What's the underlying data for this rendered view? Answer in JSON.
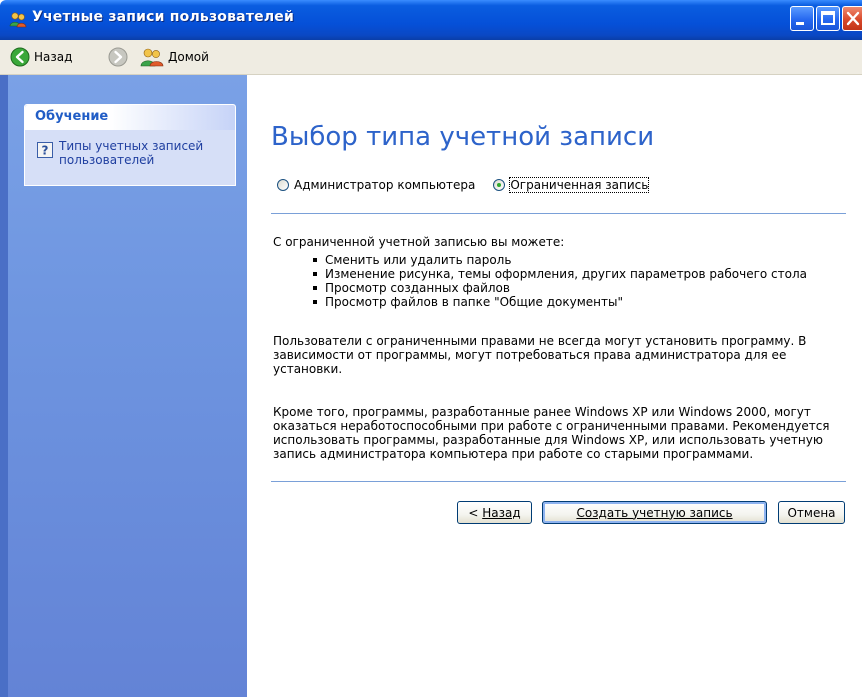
{
  "window": {
    "title": "Учетные записи пользователей"
  },
  "navbar": {
    "back_label": "Назад",
    "home_label": "Домой"
  },
  "sidebar": {
    "section_title": "Обучение",
    "links": [
      {
        "label": "Типы учетных записей пользователей",
        "icon": "help-icon"
      }
    ]
  },
  "main": {
    "heading": "Выбор типа учетной записи",
    "account_types": [
      {
        "label": "Администратор компьютера",
        "selected": false
      },
      {
        "label": "Ограниченная запись",
        "selected": true
      }
    ],
    "intro": "С ограниченной учетной записью вы можете:",
    "capabilities": [
      "Сменить или удалить пароль",
      "Изменение рисунка, темы оформления, других параметров рабочего стола",
      "Просмотр созданных файлов",
      "Просмотр файлов в папке \"Общие документы\""
    ],
    "paragraph_1": "Пользователи с ограниченными правами не всегда могут установить программу. В зависимости от программы, могут потребоваться права администратора для ее установки.",
    "paragraph_2": "Кроме того, программы, разработанные ранее Windows XP или Windows 2000, могут оказаться неработоспособными при работе с ограниченными правами. Рекомендуется использовать программы, разработанные для Windows XP, или использовать учетную запись администратора компьютера при работе со старыми программами."
  },
  "buttons": {
    "back_prefix": "< ",
    "back_label": "Назад",
    "create_label": "Создать учетную запись",
    "cancel_label": "Отмена"
  },
  "colors": {
    "titlebar": "#0550d8",
    "sidebar": "#6e95e0",
    "heading": "#2d63ca",
    "link": "#1f3fa0",
    "divider": "#7aa0d8"
  }
}
